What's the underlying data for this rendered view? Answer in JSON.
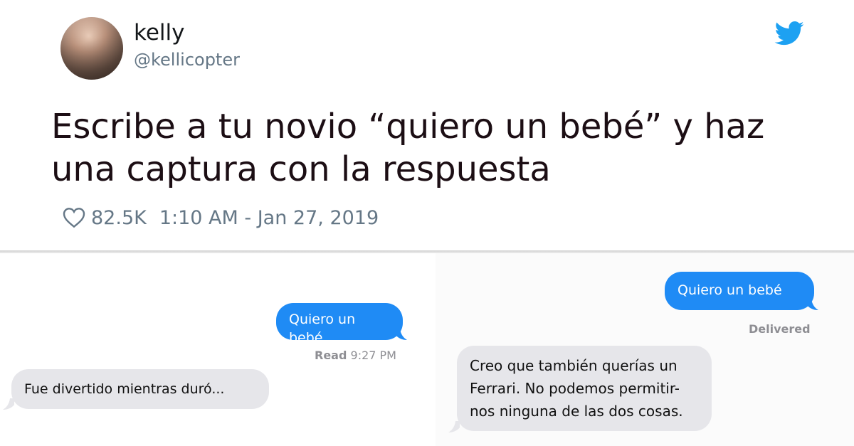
{
  "tweet": {
    "name": "kelly",
    "handle": "@kellicopter",
    "text_line1": "Escribe a tu novio “quiero un bebé” y haz",
    "text_line2": "una captura con la respuesta",
    "likes": "82.5K",
    "timestamp": "1:10 AM - Jan 27, 2019",
    "icons": {
      "brand": "twitter-bird-icon",
      "like": "heart-icon"
    },
    "colors": {
      "brand": "#1da1f2",
      "meta": "#657786"
    }
  },
  "chat_left": {
    "sent_message": "Quiero un bebé",
    "status_label": "Read",
    "status_time": "9:27 PM",
    "reply": "Fue divertido mientras duró..."
  },
  "chat_right": {
    "sent_message": "Quiero un bebé",
    "status": "Delivered",
    "reply_lines": [
      "Creo que también querías un",
      "Ferrari. No podemos permitir-",
      "nos ninguna de las dos cosas."
    ]
  },
  "colors": {
    "sent_bubble": "#1f8bf5",
    "received_bubble": "#e6e6ea"
  }
}
